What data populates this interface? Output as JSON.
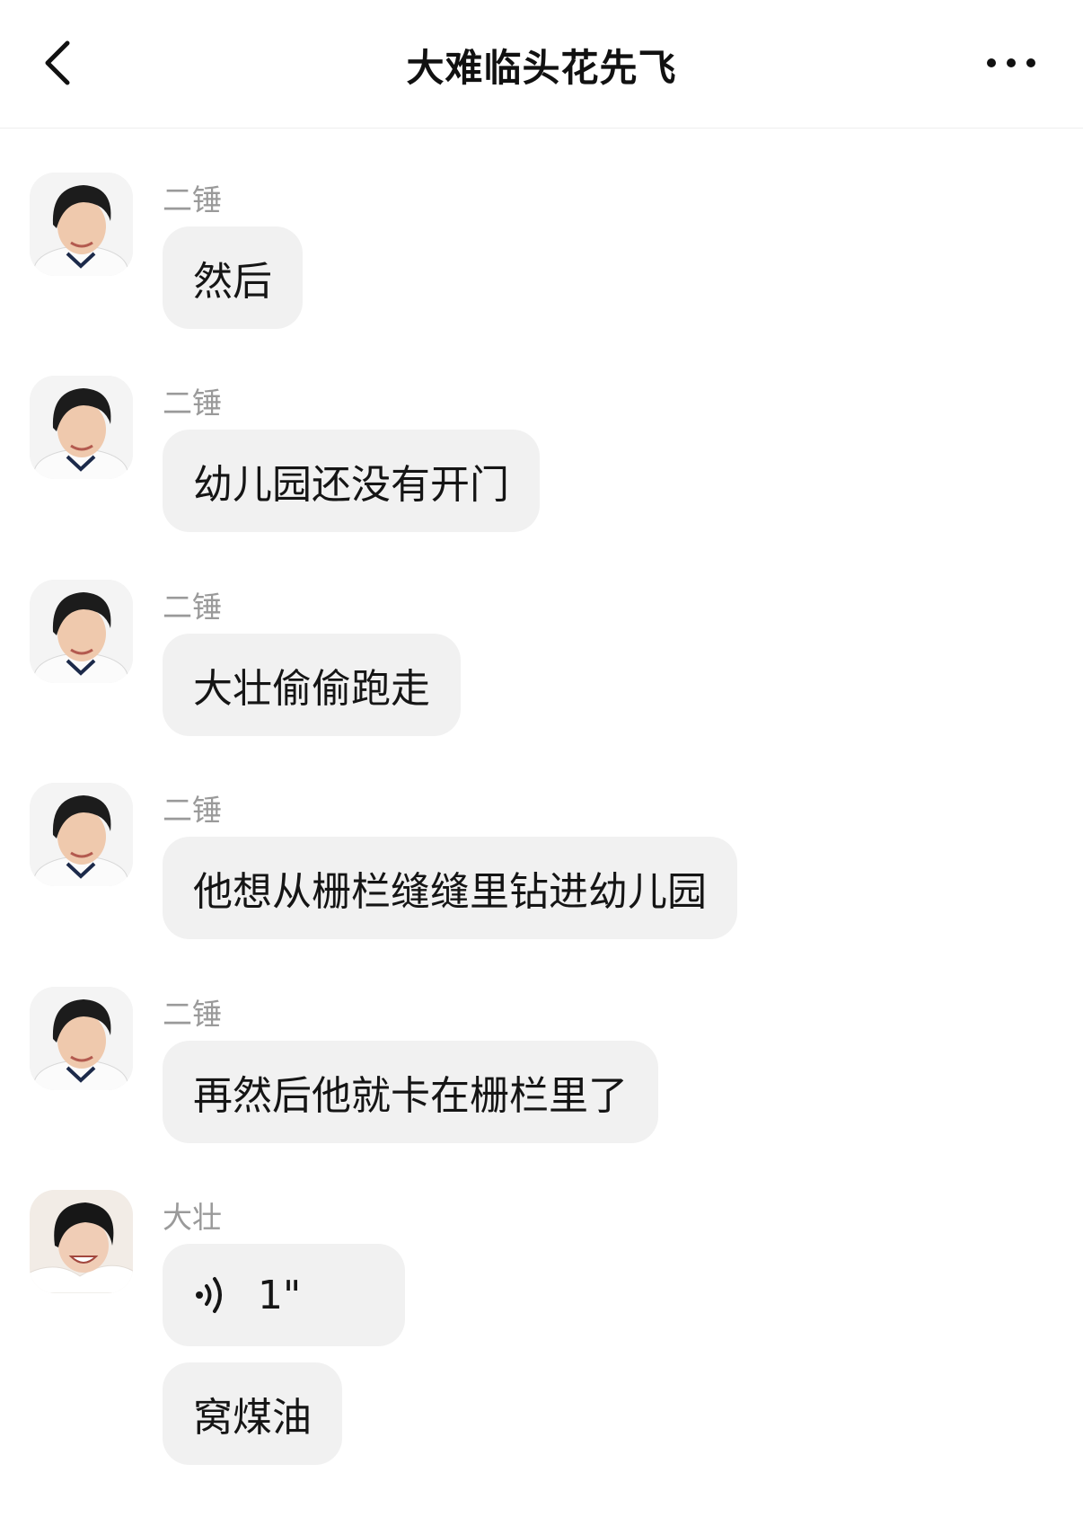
{
  "header": {
    "title": "大难临头花先飞",
    "back_icon": "chevron-left-icon",
    "more_icon": "more-dots-icon"
  },
  "messages": [
    {
      "sender": "二锤",
      "type": "text",
      "text": "然后"
    },
    {
      "sender": "二锤",
      "type": "text",
      "text": "幼儿园还没有开门"
    },
    {
      "sender": "二锤",
      "type": "text",
      "text": "大壮偷偷跑走"
    },
    {
      "sender": "二锤",
      "type": "text",
      "text": "他想从栅栏缝缝里钻进幼儿园"
    },
    {
      "sender": "二锤",
      "type": "text",
      "text": "再然后他就卡在栅栏里了"
    },
    {
      "sender": "大壮",
      "type": "voice",
      "duration": "1\"",
      "icon": "voice-wave-icon"
    },
    {
      "sender": "大壮",
      "type": "text",
      "text": "窝煤油"
    }
  ],
  "colors": {
    "bubble": "#f1f1f1",
    "sender_name": "#9a9a9a",
    "title": "#111111"
  }
}
